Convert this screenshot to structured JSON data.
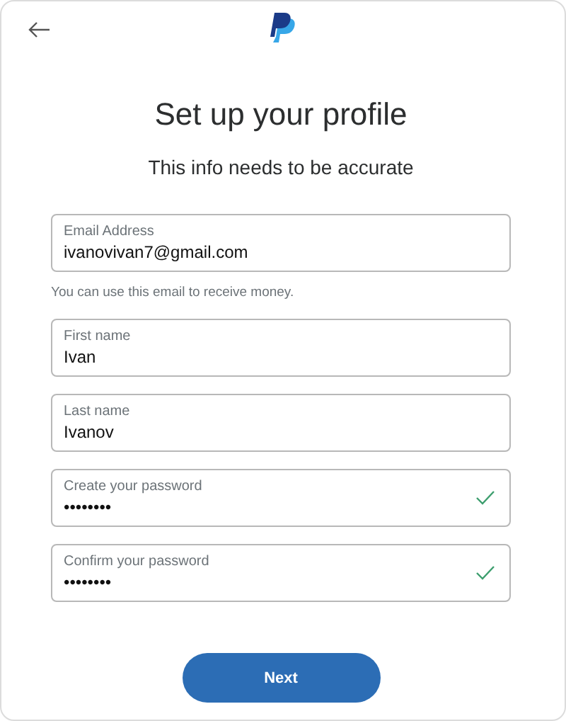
{
  "title": "Set up your profile",
  "subtitle": "This info needs to be accurate",
  "fields": [
    {
      "label": "Email Address",
      "value": "ivanovivan7@gmail.com",
      "valid": false,
      "hint": "You can use this email to receive money."
    },
    {
      "label": "First name",
      "value": "Ivan",
      "valid": false
    },
    {
      "label": "Last name",
      "value": "Ivanov",
      "valid": false
    },
    {
      "label": "Create your password",
      "value": "••••••••",
      "valid": true
    },
    {
      "label": "Confirm your password",
      "value": "••••••••",
      "valid": true
    }
  ],
  "button": "Next"
}
